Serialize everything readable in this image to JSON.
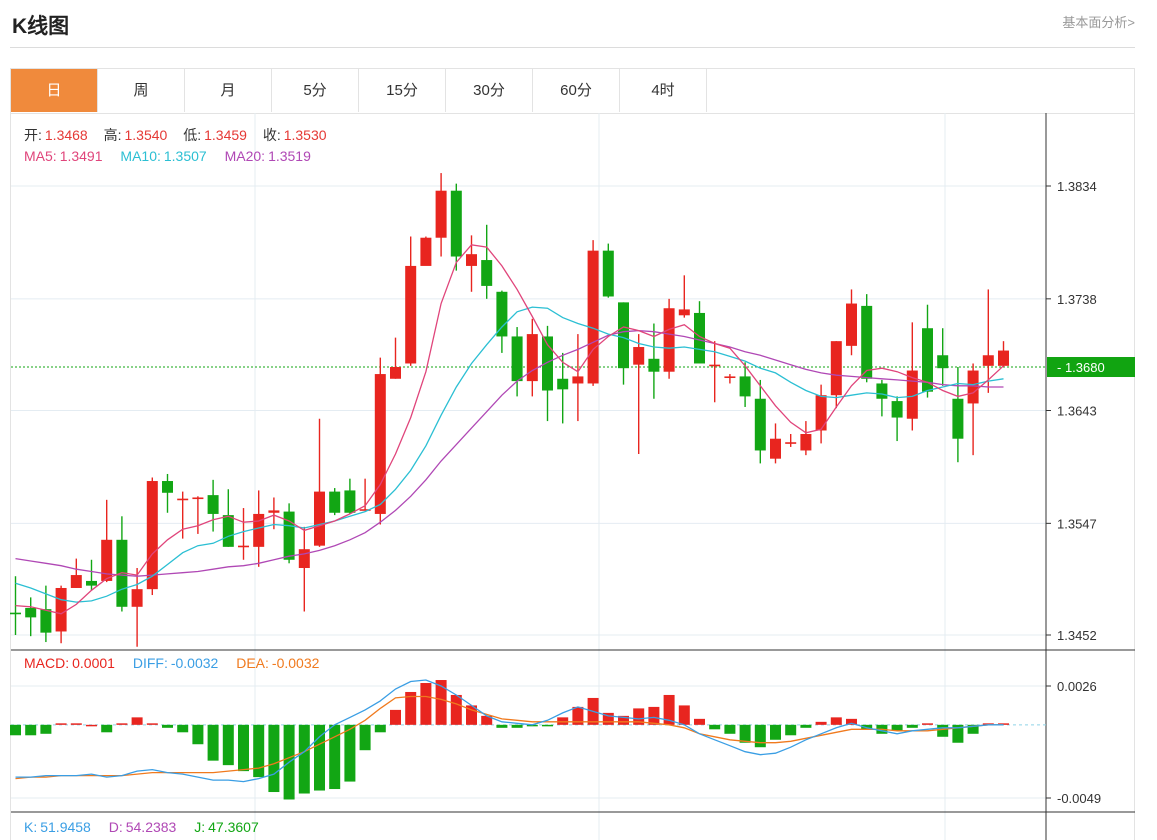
{
  "header": {
    "title": "K线图",
    "more_link": "基本面分析>"
  },
  "tabs": [
    {
      "label": "日",
      "active": true
    },
    {
      "label": "周",
      "active": false
    },
    {
      "label": "月",
      "active": false
    },
    {
      "label": "5分",
      "active": false
    },
    {
      "label": "15分",
      "active": false
    },
    {
      "label": "30分",
      "active": false
    },
    {
      "label": "60分",
      "active": false
    },
    {
      "label": "4时",
      "active": false
    }
  ],
  "ohlc_info": {
    "open_label": "开:",
    "open": "1.3468",
    "high_label": "高:",
    "high": "1.3540",
    "low_label": "低:",
    "low": "1.3459",
    "close_label": "收:",
    "close": "1.3530"
  },
  "ma_info": {
    "ma5_label": "MA5:",
    "ma5": "1.3491",
    "ma10_label": "MA10:",
    "ma10": "1.3507",
    "ma20_label": "MA20:",
    "ma20": "1.3519"
  },
  "macd_info": {
    "macd_label": "MACD:",
    "macd": "0.0001",
    "diff_label": "DIFF:",
    "diff": "-0.0032",
    "dea_label": "DEA:",
    "dea": "-0.0032"
  },
  "kdj_info": {
    "k_label": "K:",
    "k": "51.9458",
    "d_label": "D:",
    "d": "54.2383",
    "j_label": "J:",
    "j": "47.3607"
  },
  "colors": {
    "up": "#e8251f",
    "down": "#12a614",
    "ma5": "#e0457b",
    "ma10": "#2bbfd3",
    "ma20": "#b048b5",
    "diff": "#3a9ee4",
    "dea": "#f07a1e",
    "current_price": "#11a411"
  },
  "chart_data": {
    "type": "candlestick",
    "price_axis": {
      "ticks": [
        "1.3834",
        "1.3738",
        "1.3643",
        "1.3547",
        "1.3452"
      ],
      "min": 1.3452,
      "max": 1.3834
    },
    "current_price": "1.3680",
    "candles": [
      [
        1.3471,
        1.347,
        1.3502,
        1.3452
      ],
      [
        1.3475,
        1.3467,
        1.3484,
        1.3451
      ],
      [
        1.3474,
        1.3454,
        1.3494,
        1.3446
      ],
      [
        1.3455,
        1.3492,
        1.3494,
        1.3445
      ],
      [
        1.3492,
        1.3503,
        1.3517,
        1.3492
      ],
      [
        1.3498,
        1.3494,
        1.3516,
        1.349
      ],
      [
        1.3498,
        1.3533,
        1.3567,
        1.3497
      ],
      [
        1.3533,
        1.3476,
        1.3553,
        1.3472
      ],
      [
        1.3476,
        1.3491,
        1.3509,
        1.3442
      ],
      [
        1.3491,
        1.3583,
        1.3586,
        1.3486
      ],
      [
        1.3583,
        1.3573,
        1.3589,
        1.3556
      ],
      [
        1.3568,
        1.3568,
        1.3574,
        1.3534
      ],
      [
        1.3568,
        1.3569,
        1.357,
        1.3538
      ],
      [
        1.3571,
        1.3555,
        1.3584,
        1.354
      ],
      [
        1.3554,
        1.3527,
        1.3576,
        1.3527
      ],
      [
        1.3528,
        1.3528,
        1.356,
        1.3516
      ],
      [
        1.3527,
        1.3555,
        1.3575,
        1.351
      ],
      [
        1.3556,
        1.3558,
        1.3569,
        1.3542
      ],
      [
        1.3557,
        1.3516,
        1.3564,
        1.3513
      ],
      [
        1.3509,
        1.3525,
        1.3544,
        1.3472
      ],
      [
        1.3528,
        1.3574,
        1.3636,
        1.3527
      ],
      [
        1.3574,
        1.3556,
        1.3577,
        1.3554
      ],
      [
        1.3575,
        1.3556,
        1.3585,
        1.3555
      ],
      [
        1.3559,
        1.3559,
        1.3585,
        1.3558
      ],
      [
        1.3555,
        1.3674,
        1.3688,
        1.3546
      ],
      [
        1.367,
        1.368,
        1.3705,
        1.367
      ],
      [
        1.3683,
        1.3766,
        1.3791,
        1.3681
      ],
      [
        1.3766,
        1.379,
        1.3791,
        1.3767
      ],
      [
        1.379,
        1.383,
        1.3845,
        1.3774
      ],
      [
        1.383,
        1.3774,
        1.3836,
        1.3762
      ],
      [
        1.3766,
        1.3776,
        1.3792,
        1.3744
      ],
      [
        1.3771,
        1.3749,
        1.3801,
        1.3738
      ],
      [
        1.3744,
        1.3706,
        1.3745,
        1.3692
      ],
      [
        1.3706,
        1.3668,
        1.3714,
        1.3655
      ],
      [
        1.3668,
        1.3708,
        1.3721,
        1.3655
      ],
      [
        1.3706,
        1.366,
        1.3715,
        1.3634
      ],
      [
        1.367,
        1.3661,
        1.3692,
        1.3632
      ],
      [
        1.3666,
        1.3672,
        1.3708,
        1.3634
      ],
      [
        1.3666,
        1.3779,
        1.3788,
        1.3664
      ],
      [
        1.3779,
        1.374,
        1.3785,
        1.3739
      ],
      [
        1.3735,
        1.3679,
        1.3735,
        1.3665
      ],
      [
        1.3682,
        1.3697,
        1.3708,
        1.3606
      ],
      [
        1.3687,
        1.3676,
        1.3717,
        1.3653
      ],
      [
        1.3676,
        1.373,
        1.3738,
        1.367
      ],
      [
        1.3724,
        1.3729,
        1.3758,
        1.3722
      ],
      [
        1.3726,
        1.3683,
        1.3736,
        1.3683
      ],
      [
        1.3682,
        1.3682,
        1.3702,
        1.365
      ],
      [
        1.3672,
        1.3672,
        1.3674,
        1.3666
      ],
      [
        1.3672,
        1.3655,
        1.3684,
        1.3646
      ],
      [
        1.3653,
        1.3609,
        1.3669,
        1.3598
      ],
      [
        1.3602,
        1.3619,
        1.3632,
        1.3598
      ],
      [
        1.3615,
        1.3616,
        1.3623,
        1.3612
      ],
      [
        1.3609,
        1.3623,
        1.3634,
        1.3605
      ],
      [
        1.3626,
        1.3656,
        1.3665,
        1.3615
      ],
      [
        1.3656,
        1.3702,
        1.3702,
        1.3645
      ],
      [
        1.3698,
        1.3734,
        1.3746,
        1.369
      ],
      [
        1.3732,
        1.367,
        1.3742,
        1.3667
      ],
      [
        1.3666,
        1.3653,
        1.3669,
        1.3638
      ],
      [
        1.3651,
        1.3637,
        1.3655,
        1.3617
      ],
      [
        1.3636,
        1.3677,
        1.3718,
        1.3626
      ],
      [
        1.3713,
        1.3659,
        1.3733,
        1.3654
      ],
      [
        1.369,
        1.3679,
        1.3713,
        1.3664
      ],
      [
        1.3653,
        1.3619,
        1.368,
        1.3599
      ],
      [
        1.3649,
        1.3677,
        1.3683,
        1.3605
      ],
      [
        1.3681,
        1.369,
        1.3746,
        1.3658
      ],
      [
        1.3681,
        1.3694,
        1.3702,
        1.368
      ]
    ],
    "ma5": [
      1.3477,
      1.3476,
      1.3473,
      1.347,
      1.3478,
      1.349,
      1.35,
      1.3505,
      1.3503,
      1.3521,
      1.3533,
      1.3542,
      1.3545,
      1.355,
      1.3553,
      1.3548,
      1.3549,
      1.3554,
      1.3549,
      1.3541,
      1.3545,
      1.3549,
      1.3555,
      1.3562,
      1.358,
      1.3606,
      1.3637,
      1.3676,
      1.3734,
      1.3769,
      1.3784,
      1.3782,
      1.3766,
      1.3746,
      1.3723,
      1.3699,
      1.3684,
      1.3676,
      1.3695,
      1.3706,
      1.3714,
      1.3711,
      1.3706,
      1.3712,
      1.3716,
      1.3706,
      1.37,
      1.3696,
      1.3681,
      1.3664,
      1.3647,
      1.3633,
      1.3624,
      1.3627,
      1.3646,
      1.3664,
      1.3677,
      1.3679,
      1.3676,
      1.3671,
      1.3667,
      1.366,
      1.3655,
      1.3658,
      1.3669,
      1.3681
    ],
    "ma10": [
      1.3496,
      1.3492,
      1.3487,
      1.3482,
      1.348,
      1.3481,
      1.3485,
      1.3491,
      1.3495,
      1.3502,
      1.3512,
      1.3522,
      1.3528,
      1.353,
      1.3536,
      1.354,
      1.3543,
      1.3546,
      1.3545,
      1.3543,
      1.3546,
      1.3549,
      1.3553,
      1.3557,
      1.3563,
      1.3576,
      1.3592,
      1.3613,
      1.3639,
      1.3663,
      1.3683,
      1.3699,
      1.3714,
      1.3727,
      1.3731,
      1.373,
      1.3722,
      1.3717,
      1.3713,
      1.3708,
      1.3705,
      1.37,
      1.3697,
      1.3696,
      1.3697,
      1.3695,
      1.3693,
      1.3689,
      1.3685,
      1.3679,
      1.3675,
      1.3667,
      1.366,
      1.3655,
      1.3654,
      1.3656,
      1.3658,
      1.3657,
      1.3654,
      1.3655,
      1.366,
      1.3663,
      1.3666,
      1.3665,
      1.3668,
      1.367
    ],
    "ma20": [
      1.3517,
      1.3515,
      1.3513,
      1.3511,
      1.3508,
      1.3506,
      1.3504,
      1.3503,
      1.3502,
      1.3503,
      1.3504,
      1.3505,
      1.3506,
      1.3508,
      1.351,
      1.3511,
      1.3513,
      1.3516,
      1.3519,
      1.3521,
      1.3524,
      1.3528,
      1.3533,
      1.3539,
      1.3548,
      1.3558,
      1.357,
      1.3584,
      1.36,
      1.3614,
      1.3628,
      1.3642,
      1.3656,
      1.3668,
      1.3677,
      1.3684,
      1.369,
      1.3695,
      1.3701,
      1.3707,
      1.371,
      1.3711,
      1.371,
      1.3708,
      1.3706,
      1.3703,
      1.37,
      1.3697,
      1.3693,
      1.369,
      1.3686,
      1.3682,
      1.3678,
      1.3675,
      1.3673,
      1.3672,
      1.3671,
      1.367,
      1.3669,
      1.3668,
      1.3667,
      1.3665,
      1.3664,
      1.3664,
      1.3663,
      1.3663
    ],
    "macd_axis": {
      "ticks": [
        "0.0026",
        "-0.0049"
      ],
      "min": -0.0049,
      "max": 0.0026
    },
    "macd_hist": [
      -0.0007,
      -0.0007,
      -0.0006,
      0.0001,
      0.0001,
      0.0,
      -0.0005,
      0.0001,
      0.0005,
      0.0001,
      -0.0002,
      -0.0005,
      -0.0013,
      -0.0024,
      -0.0027,
      -0.0031,
      -0.0035,
      -0.0045,
      -0.005,
      -0.0046,
      -0.0044,
      -0.0043,
      -0.0038,
      -0.0017,
      -0.0005,
      0.001,
      0.0022,
      0.0028,
      0.003,
      0.002,
      0.0013,
      0.0006,
      -0.0002,
      -0.0002,
      -0.0001,
      -0.0001,
      0.0005,
      0.0012,
      0.0018,
      0.0008,
      0.0006,
      0.0011,
      0.0012,
      0.002,
      0.0013,
      0.0004,
      -0.0003,
      -0.0006,
      -0.0012,
      -0.0015,
      -0.001,
      -0.0007,
      -0.0002,
      0.0002,
      0.0005,
      0.0004,
      -0.0003,
      -0.0006,
      -0.0004,
      -0.0002,
      0.0001,
      -0.0008,
      -0.0012,
      -0.0006,
      0.0001,
      0.0001
    ],
    "diff": [
      -0.0035,
      -0.0035,
      -0.0034,
      -0.0034,
      -0.0034,
      -0.0033,
      -0.0035,
      -0.0034,
      -0.0031,
      -0.003,
      -0.0032,
      -0.0033,
      -0.0035,
      -0.0037,
      -0.0037,
      -0.0038,
      -0.0036,
      -0.0033,
      -0.0025,
      -0.0018,
      -0.0008,
      0.0,
      0.0005,
      0.001,
      0.0016,
      0.0024,
      0.0029,
      0.003,
      0.0026,
      0.002,
      0.0013,
      0.0006,
      0.0002,
      0.0001,
      0.0,
      0.0003,
      0.0008,
      0.0012,
      0.0009,
      0.0006,
      0.0005,
      0.0004,
      0.0005,
      0.0003,
      0.0,
      -0.0006,
      -0.001,
      -0.0014,
      -0.0018,
      -0.002,
      -0.0019,
      -0.0015,
      -0.001,
      -0.0006,
      -0.0002,
      0.0001,
      -0.0002,
      -0.0004,
      -0.0006,
      -0.0004,
      -0.0003,
      -0.0002,
      -0.0002,
      -0.0001,
      0.0,
      0.0
    ],
    "dea": [
      -0.0036,
      -0.0035,
      -0.0035,
      -0.0034,
      -0.0034,
      -0.0034,
      -0.0034,
      -0.0034,
      -0.0033,
      -0.0032,
      -0.0032,
      -0.0032,
      -0.0032,
      -0.0032,
      -0.0031,
      -0.003,
      -0.0029,
      -0.0026,
      -0.0022,
      -0.0018,
      -0.0013,
      -0.0008,
      -0.0003,
      0.0003,
      0.0011,
      0.0018,
      0.0019,
      0.0019,
      0.0017,
      0.0014,
      0.001,
      0.0007,
      0.0004,
      0.0003,
      0.0002,
      0.0002,
      0.0002,
      0.0002,
      0.0002,
      0.0002,
      0.0002,
      0.0002,
      0.0001,
      0.0,
      -0.0002,
      -0.0006,
      -0.0008,
      -0.001,
      -0.0011,
      -0.0012,
      -0.0012,
      -0.0011,
      -0.0009,
      -0.0007,
      -0.0005,
      -0.0003,
      -0.0003,
      -0.0003,
      -0.0004,
      -0.0004,
      -0.0004,
      -0.0003,
      -0.0002,
      -0.0001,
      0.0,
      0.0
    ]
  }
}
